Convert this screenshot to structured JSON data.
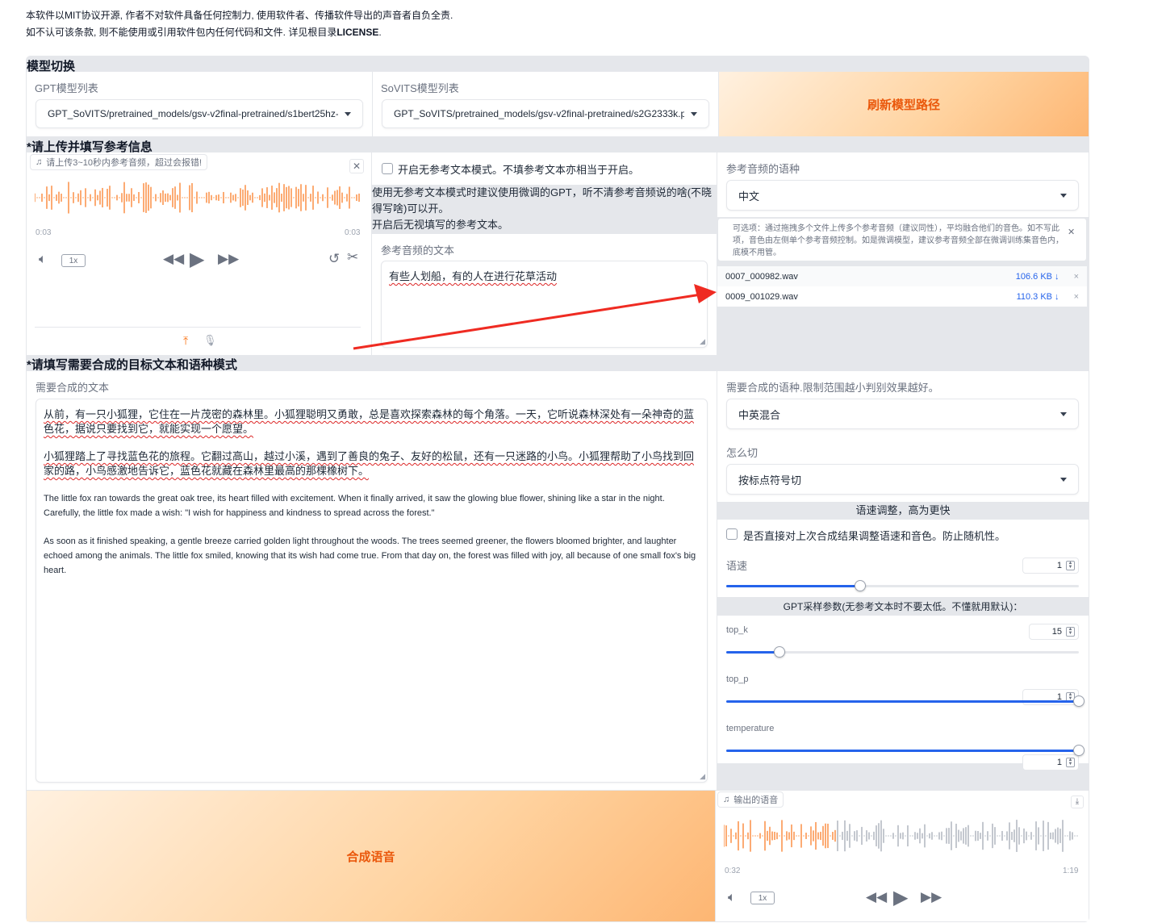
{
  "notice": {
    "line1": "本软件以MIT协议开源, 作者不对软件具备任何控制力, 使用软件者、传播软件导出的声音者自负全责.",
    "line2_prefix": "如不认可该条款, 则不能使用或引用软件包内任何代码和文件. 详见根目录",
    "line2_license": "LICENSE",
    "line2_suffix": "."
  },
  "model_switch": {
    "title": "模型切换",
    "gpt_label": "GPT模型列表",
    "gpt_value": "GPT_SoVITS/pretrained_models/gsv-v2final-pretrained/s1bert25hz-",
    "sovits_label": "SoVITS模型列表",
    "sovits_value": "GPT_SoVITS/pretrained_models/gsv-v2final-pretrained/s2G2333k.p",
    "refresh_button": "刷新模型路径"
  },
  "reference": {
    "title": "*请上传并填写参考信息",
    "audio_chip": "请上传3~10秒内参考音频，超过会报错!",
    "time_start": "0:03",
    "time_end": "0:03",
    "rate": "1x",
    "no_ref_checkbox": "开启无参考文本模式。不填参考文本亦相当于开启。",
    "no_ref_hint_1": "使用无参考文本模式时建议使用微调的GPT，听不清参考音频说的啥(不晓得写啥)可以开。",
    "no_ref_hint_2": "开启后无视填写的参考文本。",
    "ref_text_label": "参考音频的文本",
    "ref_text_value": "有些人划船，有的人在进行花草活动",
    "lang_label": "参考音频的语种",
    "lang_value": "中文",
    "optional_hint": "可选项：通过拖拽多个文件上传多个参考音频（建议同性），平均融合他们的音色。如不写此项，音色由左侧单个参考音频控制。如是微调模型，建议参考音频全部在微调训练集音色内，底模不用管。",
    "files": [
      {
        "name": "0007_000982.wav",
        "size": "106.6 KB ↓",
        "remove": "×"
      },
      {
        "name": "0009_001029.wav",
        "size": "110.3 KB ↓",
        "remove": "×"
      }
    ]
  },
  "target": {
    "title": "*请填写需要合成的目标文本和语种模式",
    "text_label": "需要合成的文本",
    "para1": "从前，有一只小狐狸，它住在一片茂密的森林里。小狐狸聪明又勇敢，总是喜欢探索森林的每个角落。一天，它听说森林深处有一朵神奇的蓝色花，据说只要找到它，就能实现一个愿望。",
    "para2": "小狐狸踏上了寻找蓝色花的旅程。它翻过高山，越过小溪，遇到了善良的兔子、友好的松鼠，还有一只迷路的小鸟。小狐狸帮助了小鸟找到回家的路，小鸟感激地告诉它，蓝色花就藏在森林里最高的那棵橡树下。",
    "para3": "The little fox ran towards the great oak tree, its heart filled with excitement. When it finally arrived, it saw the glowing blue flower, shining like a star in the night. Carefully, the little fox made a wish: \"I wish for happiness and kindness to spread across the forest.\"",
    "para4": "As soon as it finished speaking, a gentle breeze carried golden light throughout the woods. The trees seemed greener, the flowers bloomed brighter, and laughter echoed among the animals. The little fox smiled, knowing that its wish had come true. From that day on, the forest was filled with joy, all because of one small fox's big heart.",
    "lang_label": "需要合成的语种.限制范围越小判别效果越好。",
    "lang_value": "中英混合",
    "cut_label": "怎么切",
    "cut_value": "按标点符号切",
    "speed_bar_title": "语速调整，高为更快",
    "speed_checkbox": "是否直接对上次合成结果调整语速和音色。防止随机性。",
    "speed_label": "语速",
    "speed_value": "1",
    "speed_fraction": 0.38,
    "gpt_bar_title": "GPT采样参数(无参考文本时不要太低。不懂就用默认)：",
    "top_k_label": "top_k",
    "top_k_value": "15",
    "top_k_fraction": 0.15,
    "top_p_label": "top_p",
    "top_p_value": "1",
    "top_p_fraction": 1.0,
    "temperature_label": "temperature",
    "temperature_value": "1",
    "temperature_fraction": 1.0,
    "synth_button": "合成语音"
  },
  "output": {
    "chip": "输出的语音",
    "time_current": "0:32",
    "time_total": "1:19",
    "rate": "1x",
    "progress_fraction": 0.32
  },
  "colors": {
    "accent_orange": "#ea580c",
    "waveform_orange": "#f97316",
    "waveform_gray": "#9ca3af",
    "slider_blue": "#2563eb",
    "arrow_red": "#ef2b22"
  }
}
